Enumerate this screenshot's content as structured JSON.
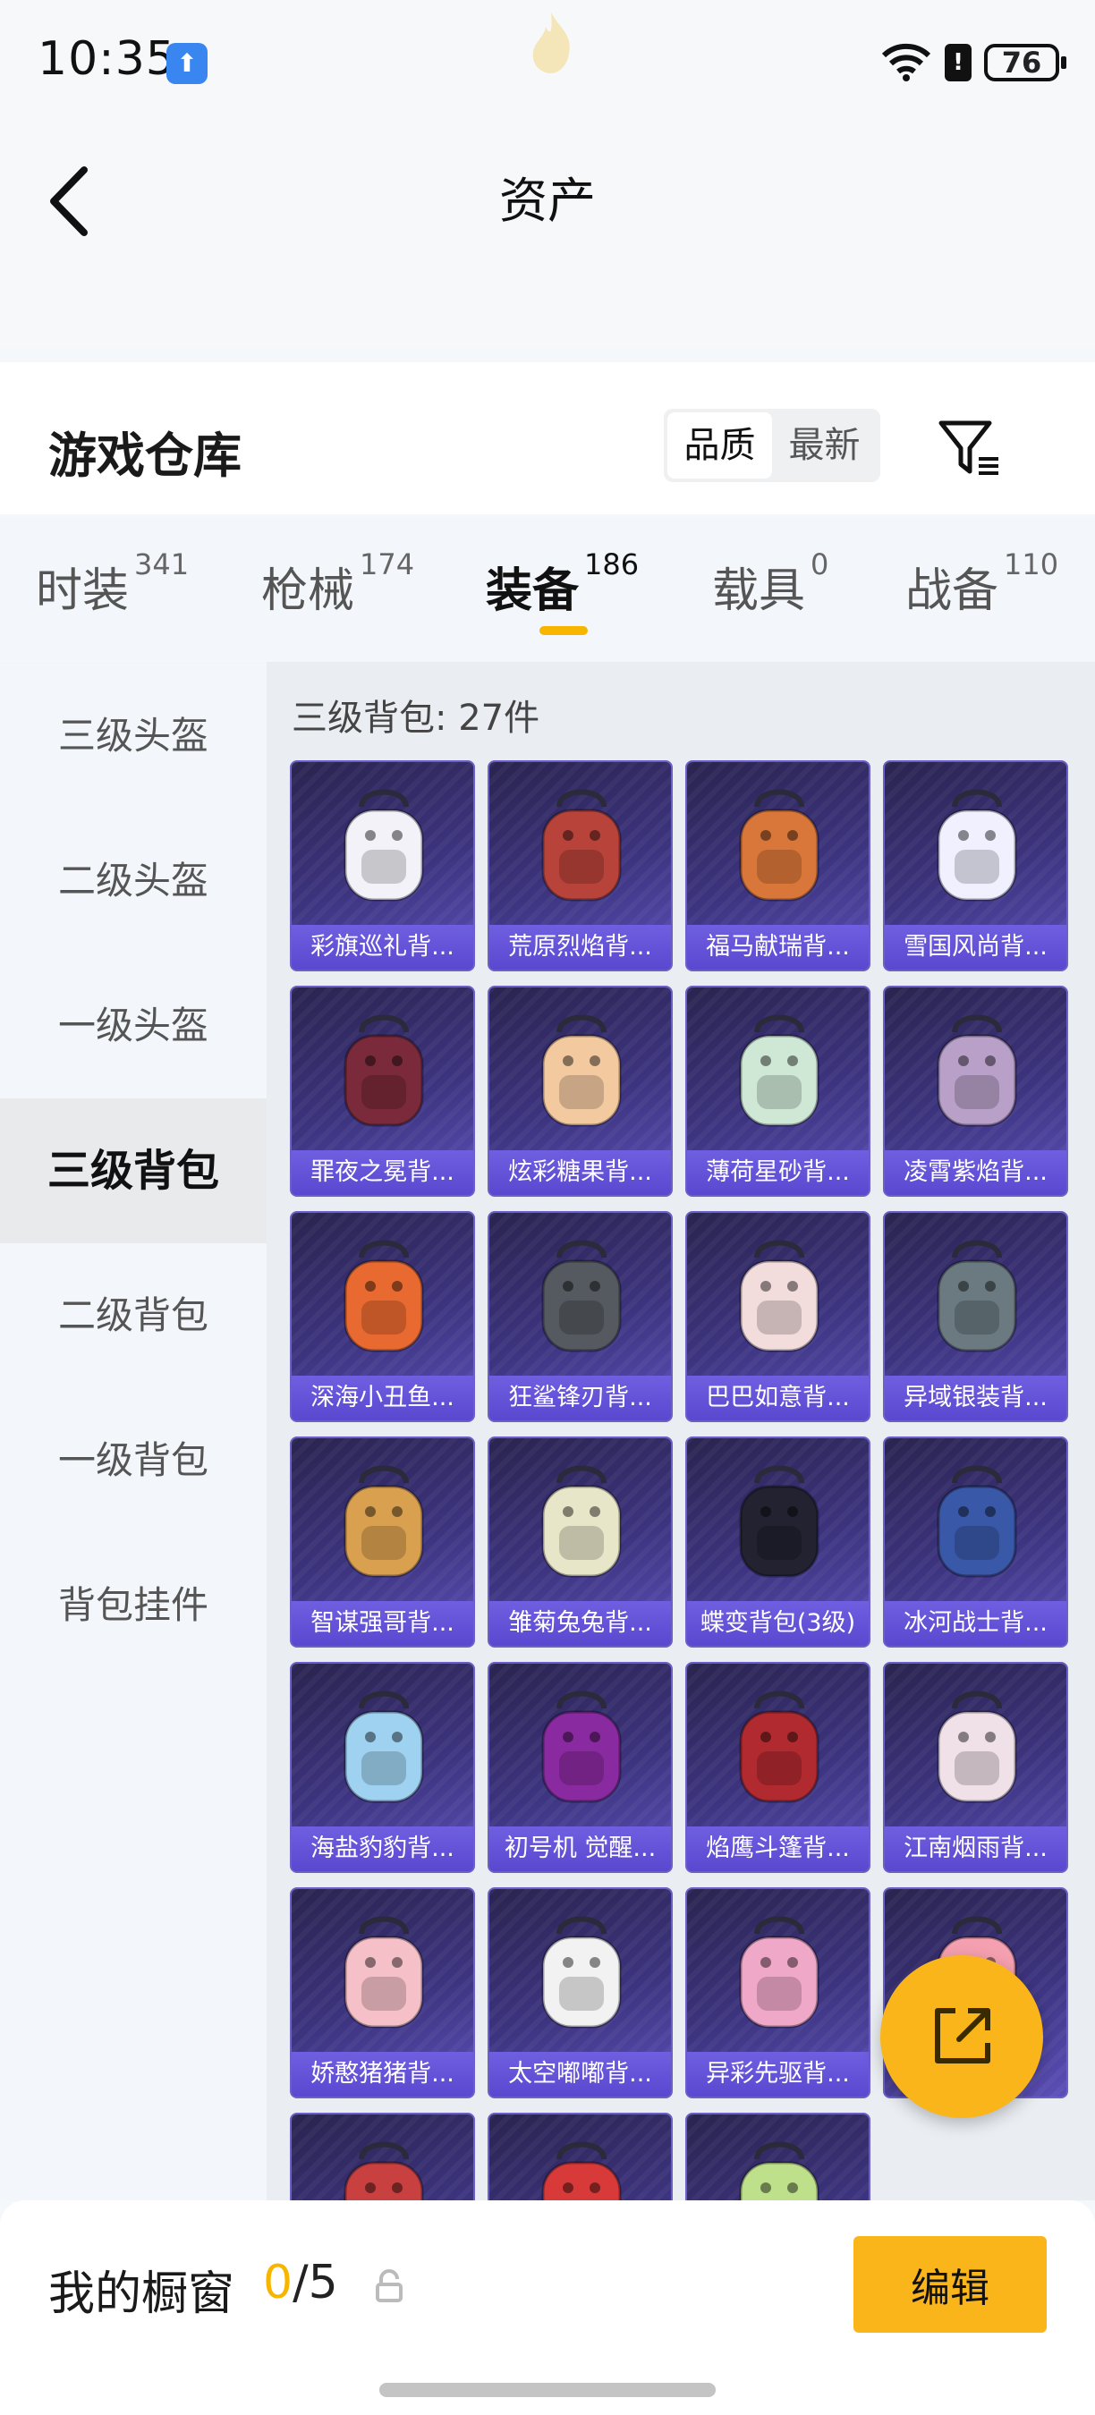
{
  "status_bar": {
    "time": "10:35",
    "battery": "76",
    "alert": "!"
  },
  "header": {
    "title": "资产"
  },
  "warehouse": {
    "title": "游戏仓库",
    "sort_options": [
      "品质",
      "最新"
    ],
    "active_sort": "品质"
  },
  "tabs": [
    {
      "label": "时装",
      "count": "341"
    },
    {
      "label": "枪械",
      "count": "174"
    },
    {
      "label": "装备",
      "count": "186",
      "active": true
    },
    {
      "label": "载具",
      "count": "0"
    },
    {
      "label": "战备",
      "count": "110"
    }
  ],
  "sidebar": {
    "items": [
      "三级头盔",
      "二级头盔",
      "一级头盔",
      "三级背包",
      "二级背包",
      "一级背包",
      "背包挂件"
    ],
    "active": "三级背包"
  },
  "content": {
    "title": "三级背包: 27件",
    "items": [
      "彩旗巡礼背...",
      "荒原烈焰背...",
      "福马献瑞背...",
      "雪国风尚背...",
      "罪夜之冕背...",
      "炫彩糖果背...",
      "薄荷星砂背...",
      "凌霄紫焰背...",
      "深海小丑鱼...",
      "狂鲨锋刃背...",
      "巴巴如意背...",
      "异域银装背...",
      "智谋强哥背...",
      "雏菊兔兔背...",
      "蝶变背包(3级)",
      "冰河战士背...",
      "海盐豹豹背...",
      "初号机 觉醒...",
      "焰鹰斗篷背...",
      "江南烟雨背...",
      "娇憨猪猪背...",
      "太空嘟嘟背...",
      "异彩先驱背...",
      "",
      "",
      "",
      ""
    ]
  },
  "colors": {
    "accent": "#f9b51a",
    "card_bg": "#3d3480",
    "card_label": "#5a48d0"
  },
  "bottom_bar": {
    "title": "我的橱窗",
    "used": "0",
    "total": "/5",
    "edit_label": "编辑"
  }
}
